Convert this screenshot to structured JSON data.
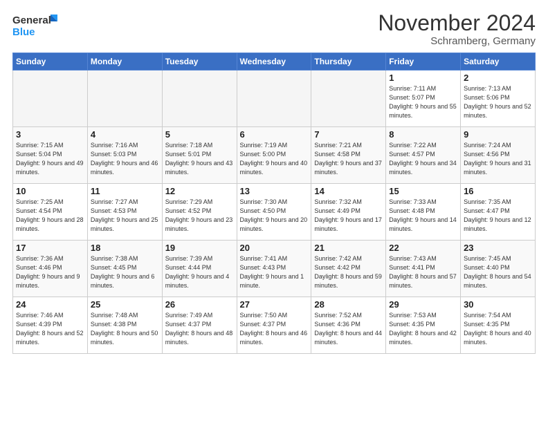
{
  "header": {
    "logo_general": "General",
    "logo_blue": "Blue",
    "month_title": "November 2024",
    "location": "Schramberg, Germany"
  },
  "days_of_week": [
    "Sunday",
    "Monday",
    "Tuesday",
    "Wednesday",
    "Thursday",
    "Friday",
    "Saturday"
  ],
  "weeks": [
    [
      {
        "day": "",
        "info": ""
      },
      {
        "day": "",
        "info": ""
      },
      {
        "day": "",
        "info": ""
      },
      {
        "day": "",
        "info": ""
      },
      {
        "day": "",
        "info": ""
      },
      {
        "day": "1",
        "info": "Sunrise: 7:11 AM\nSunset: 5:07 PM\nDaylight: 9 hours and 55 minutes."
      },
      {
        "day": "2",
        "info": "Sunrise: 7:13 AM\nSunset: 5:06 PM\nDaylight: 9 hours and 52 minutes."
      }
    ],
    [
      {
        "day": "3",
        "info": "Sunrise: 7:15 AM\nSunset: 5:04 PM\nDaylight: 9 hours and 49 minutes."
      },
      {
        "day": "4",
        "info": "Sunrise: 7:16 AM\nSunset: 5:03 PM\nDaylight: 9 hours and 46 minutes."
      },
      {
        "day": "5",
        "info": "Sunrise: 7:18 AM\nSunset: 5:01 PM\nDaylight: 9 hours and 43 minutes."
      },
      {
        "day": "6",
        "info": "Sunrise: 7:19 AM\nSunset: 5:00 PM\nDaylight: 9 hours and 40 minutes."
      },
      {
        "day": "7",
        "info": "Sunrise: 7:21 AM\nSunset: 4:58 PM\nDaylight: 9 hours and 37 minutes."
      },
      {
        "day": "8",
        "info": "Sunrise: 7:22 AM\nSunset: 4:57 PM\nDaylight: 9 hours and 34 minutes."
      },
      {
        "day": "9",
        "info": "Sunrise: 7:24 AM\nSunset: 4:56 PM\nDaylight: 9 hours and 31 minutes."
      }
    ],
    [
      {
        "day": "10",
        "info": "Sunrise: 7:25 AM\nSunset: 4:54 PM\nDaylight: 9 hours and 28 minutes."
      },
      {
        "day": "11",
        "info": "Sunrise: 7:27 AM\nSunset: 4:53 PM\nDaylight: 9 hours and 25 minutes."
      },
      {
        "day": "12",
        "info": "Sunrise: 7:29 AM\nSunset: 4:52 PM\nDaylight: 9 hours and 23 minutes."
      },
      {
        "day": "13",
        "info": "Sunrise: 7:30 AM\nSunset: 4:50 PM\nDaylight: 9 hours and 20 minutes."
      },
      {
        "day": "14",
        "info": "Sunrise: 7:32 AM\nSunset: 4:49 PM\nDaylight: 9 hours and 17 minutes."
      },
      {
        "day": "15",
        "info": "Sunrise: 7:33 AM\nSunset: 4:48 PM\nDaylight: 9 hours and 14 minutes."
      },
      {
        "day": "16",
        "info": "Sunrise: 7:35 AM\nSunset: 4:47 PM\nDaylight: 9 hours and 12 minutes."
      }
    ],
    [
      {
        "day": "17",
        "info": "Sunrise: 7:36 AM\nSunset: 4:46 PM\nDaylight: 9 hours and 9 minutes."
      },
      {
        "day": "18",
        "info": "Sunrise: 7:38 AM\nSunset: 4:45 PM\nDaylight: 9 hours and 6 minutes."
      },
      {
        "day": "19",
        "info": "Sunrise: 7:39 AM\nSunset: 4:44 PM\nDaylight: 9 hours and 4 minutes."
      },
      {
        "day": "20",
        "info": "Sunrise: 7:41 AM\nSunset: 4:43 PM\nDaylight: 9 hours and 1 minute."
      },
      {
        "day": "21",
        "info": "Sunrise: 7:42 AM\nSunset: 4:42 PM\nDaylight: 8 hours and 59 minutes."
      },
      {
        "day": "22",
        "info": "Sunrise: 7:43 AM\nSunset: 4:41 PM\nDaylight: 8 hours and 57 minutes."
      },
      {
        "day": "23",
        "info": "Sunrise: 7:45 AM\nSunset: 4:40 PM\nDaylight: 8 hours and 54 minutes."
      }
    ],
    [
      {
        "day": "24",
        "info": "Sunrise: 7:46 AM\nSunset: 4:39 PM\nDaylight: 8 hours and 52 minutes."
      },
      {
        "day": "25",
        "info": "Sunrise: 7:48 AM\nSunset: 4:38 PM\nDaylight: 8 hours and 50 minutes."
      },
      {
        "day": "26",
        "info": "Sunrise: 7:49 AM\nSunset: 4:37 PM\nDaylight: 8 hours and 48 minutes."
      },
      {
        "day": "27",
        "info": "Sunrise: 7:50 AM\nSunset: 4:37 PM\nDaylight: 8 hours and 46 minutes."
      },
      {
        "day": "28",
        "info": "Sunrise: 7:52 AM\nSunset: 4:36 PM\nDaylight: 8 hours and 44 minutes."
      },
      {
        "day": "29",
        "info": "Sunrise: 7:53 AM\nSunset: 4:35 PM\nDaylight: 8 hours and 42 minutes."
      },
      {
        "day": "30",
        "info": "Sunrise: 7:54 AM\nSunset: 4:35 PM\nDaylight: 8 hours and 40 minutes."
      }
    ]
  ]
}
